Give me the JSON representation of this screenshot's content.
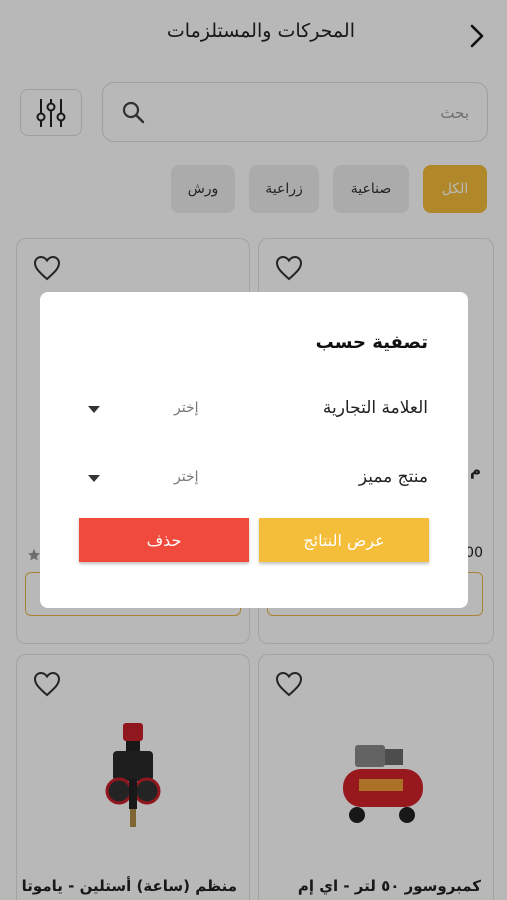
{
  "header": {
    "title": "المحركات والمستلزمات",
    "back_icon": "chevron-right-icon"
  },
  "search": {
    "placeholder": "بحث",
    "icon": "search-icon",
    "filter_icon": "sliders-icon"
  },
  "chips": [
    {
      "label": "الكل",
      "active": true
    },
    {
      "label": "صناعية",
      "active": false
    },
    {
      "label": "زراعية",
      "active": false
    },
    {
      "label": "ورش",
      "active": false
    }
  ],
  "products": {
    "top_right_name_fragment": "م",
    "top_right_price_fragment": "00",
    "bottom_right_name": "كمبروسور ٥٠ لتر - اي إم",
    "bottom_left_name": "منظم (ساعة) أستلين - ياموتا"
  },
  "modal": {
    "title": "تصفية حسب",
    "filters": [
      {
        "label": "العلامة التجارية",
        "value": "إختر"
      },
      {
        "label": "منتج مميز",
        "value": "إختر"
      }
    ],
    "apply_label": "عرض النتائج",
    "delete_label": "حذف"
  },
  "colors": {
    "accent": "#f4bd3a",
    "danger": "#f04a3c",
    "overlay": "rgba(0,0,0,0.28)"
  }
}
